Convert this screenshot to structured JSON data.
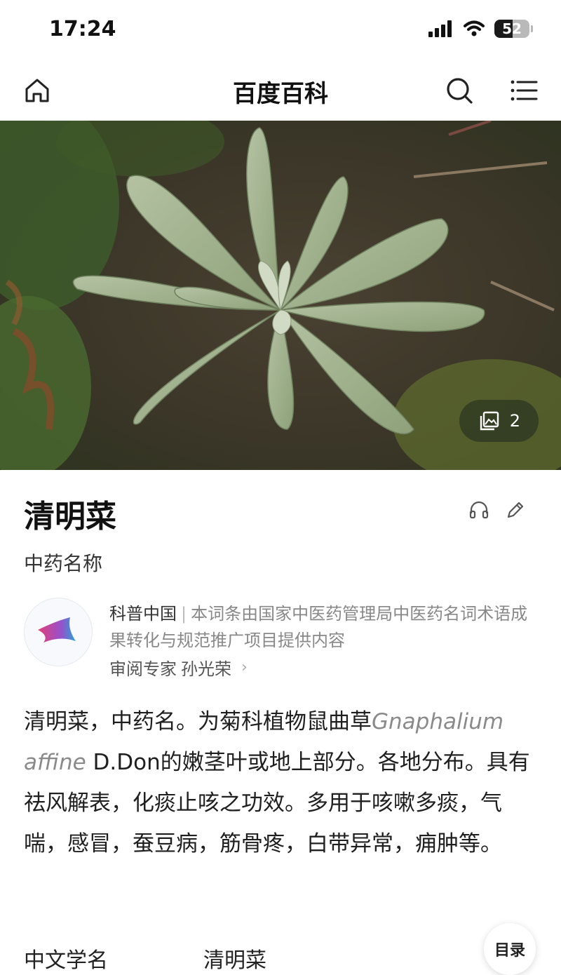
{
  "status_bar": {
    "time": "17:24",
    "battery_level": "52",
    "battery_fraction": 0.52
  },
  "nav": {
    "title": "百度百科",
    "home_icon": "home-icon",
    "search_icon": "search-icon",
    "menu_icon": "menu-icon"
  },
  "hero": {
    "image_description_icon": "gallery-icon",
    "image_count": "2"
  },
  "article": {
    "title": "清明菜",
    "subtitle": "中药名称",
    "listen_icon": "headphones-icon",
    "edit_icon": "pencil-icon"
  },
  "source": {
    "org": "科普中国",
    "separator": "|",
    "description": "本词条由国家中医药管理局中医药名词术语成果转化与规范推广项目提供内容",
    "reviewer_label": "审阅专家",
    "reviewer_name": "孙光荣",
    "chevron": "›"
  },
  "summary": {
    "part1": "清明菜，中药名。为菊科植物鼠曲草",
    "latin_name": "Gnaphalium affine",
    "part2": " D.Don的嫩茎叶或地上部分。各地分布。具有祛风解表，化痰止咳之功效。多用于咳嗽多痰，气喘，感冒，蚕豆病，筋骨疼，白带异常，痈肿等。"
  },
  "basic_info": {
    "label": "中文学名",
    "value": "清明菜"
  },
  "toc_button": "目录",
  "colors": {
    "text_primary": "#1f1f1f",
    "text_secondary": "#888888",
    "latin_gray": "#8a8a8a"
  }
}
